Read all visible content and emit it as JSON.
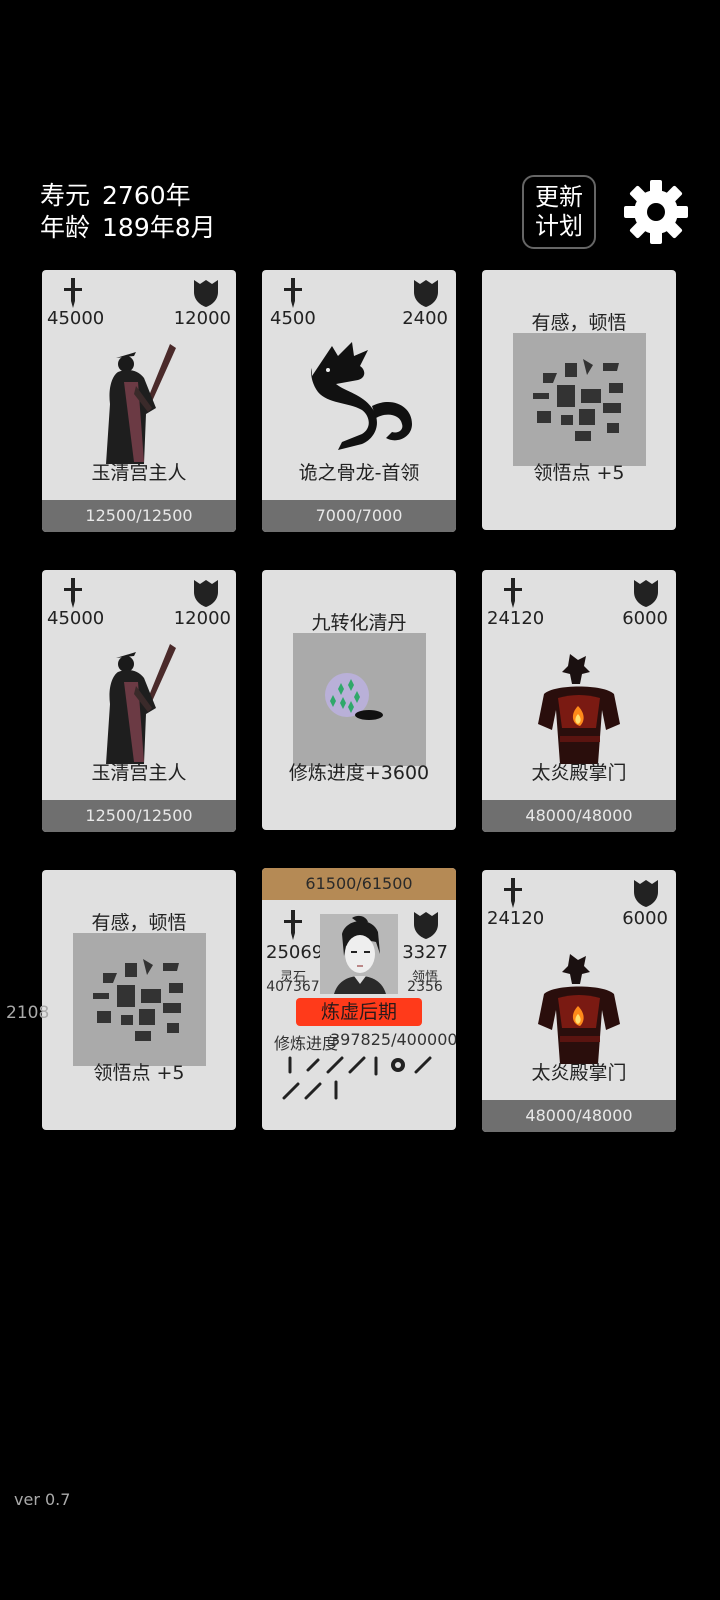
{
  "header": {
    "lifespan_label": "寿元",
    "lifespan_value": "2760年",
    "age_label": "年龄",
    "age_value": "189年8月",
    "plan_button_line1": "更新",
    "plan_button_line2": "计划"
  },
  "cards": [
    {
      "type": "enemy",
      "attack": "45000",
      "defense": "12000",
      "name": "玉清宫主人",
      "hp": "12500/12500",
      "figure": "robed-cultivator"
    },
    {
      "type": "enemy",
      "attack": "4500",
      "defense": "2400",
      "name": "诡之骨龙-首领",
      "hp": "7000/7000",
      "figure": "bone-dragon"
    },
    {
      "type": "insight",
      "title": "有感，顿悟",
      "reward": "领悟点  +5"
    },
    {
      "type": "enemy",
      "attack": "45000",
      "defense": "12000",
      "name": "玉清宫主人",
      "hp": "12500/12500",
      "figure": "robed-cultivator"
    },
    {
      "type": "item",
      "title": "九转化清丹",
      "reward": "修炼进度+3600"
    },
    {
      "type": "enemy",
      "attack": "24120",
      "defense": "6000",
      "name": "太炎殿掌门",
      "hp": "48000/48000",
      "figure": "flame-master"
    },
    {
      "type": "insight",
      "title": "有感，顿悟",
      "reward": "领悟点  +5"
    },
    {
      "type": "player",
      "hp": "61500/61500",
      "attack": "25069",
      "defense": "3327",
      "stone_label": "灵石",
      "stone_value": "407367",
      "insight_label": "领悟",
      "insight_value": "2356",
      "realm": "炼虚后期",
      "progress_label": "修炼进度",
      "progress_value": "397825/400000"
    },
    {
      "type": "enemy",
      "attack": "24120",
      "defense": "6000",
      "name": "太炎殿掌门",
      "hp": "48000/48000",
      "figure": "flame-master"
    }
  ],
  "side_number": "2108",
  "version": "ver 0.7",
  "icons": [
    "sword-icon",
    "shield-icon",
    "gear-icon"
  ],
  "colors": {
    "background": "#000000",
    "card": "#e0e0e0",
    "hp_bar": "#6f6f6f",
    "player_bar": "#b58a55",
    "realm_badge": "#ff3a1a"
  }
}
